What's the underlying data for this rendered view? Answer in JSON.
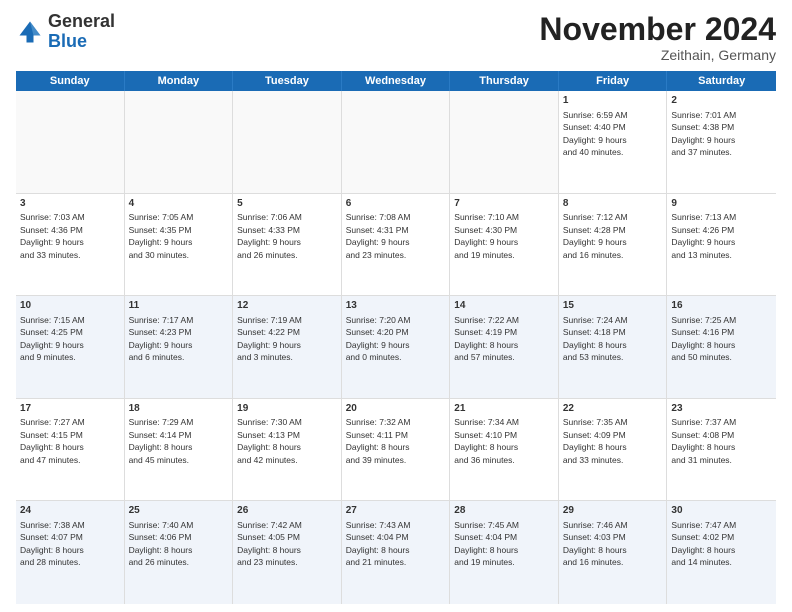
{
  "header": {
    "logo_general": "General",
    "logo_blue": "Blue",
    "month_title": "November 2024",
    "location": "Zeithain, Germany"
  },
  "calendar": {
    "day_headers": [
      "Sunday",
      "Monday",
      "Tuesday",
      "Wednesday",
      "Thursday",
      "Friday",
      "Saturday"
    ],
    "rows": [
      {
        "alt": false,
        "cells": [
          {
            "day": "",
            "info": "",
            "empty": true
          },
          {
            "day": "",
            "info": "",
            "empty": true
          },
          {
            "day": "",
            "info": "",
            "empty": true
          },
          {
            "day": "",
            "info": "",
            "empty": true
          },
          {
            "day": "",
            "info": "",
            "empty": true
          },
          {
            "day": "1",
            "info": "Sunrise: 6:59 AM\nSunset: 4:40 PM\nDaylight: 9 hours\nand 40 minutes.",
            "empty": false
          },
          {
            "day": "2",
            "info": "Sunrise: 7:01 AM\nSunset: 4:38 PM\nDaylight: 9 hours\nand 37 minutes.",
            "empty": false
          }
        ]
      },
      {
        "alt": false,
        "cells": [
          {
            "day": "3",
            "info": "Sunrise: 7:03 AM\nSunset: 4:36 PM\nDaylight: 9 hours\nand 33 minutes.",
            "empty": false
          },
          {
            "day": "4",
            "info": "Sunrise: 7:05 AM\nSunset: 4:35 PM\nDaylight: 9 hours\nand 30 minutes.",
            "empty": false
          },
          {
            "day": "5",
            "info": "Sunrise: 7:06 AM\nSunset: 4:33 PM\nDaylight: 9 hours\nand 26 minutes.",
            "empty": false
          },
          {
            "day": "6",
            "info": "Sunrise: 7:08 AM\nSunset: 4:31 PM\nDaylight: 9 hours\nand 23 minutes.",
            "empty": false
          },
          {
            "day": "7",
            "info": "Sunrise: 7:10 AM\nSunset: 4:30 PM\nDaylight: 9 hours\nand 19 minutes.",
            "empty": false
          },
          {
            "day": "8",
            "info": "Sunrise: 7:12 AM\nSunset: 4:28 PM\nDaylight: 9 hours\nand 16 minutes.",
            "empty": false
          },
          {
            "day": "9",
            "info": "Sunrise: 7:13 AM\nSunset: 4:26 PM\nDaylight: 9 hours\nand 13 minutes.",
            "empty": false
          }
        ]
      },
      {
        "alt": true,
        "cells": [
          {
            "day": "10",
            "info": "Sunrise: 7:15 AM\nSunset: 4:25 PM\nDaylight: 9 hours\nand 9 minutes.",
            "empty": false
          },
          {
            "day": "11",
            "info": "Sunrise: 7:17 AM\nSunset: 4:23 PM\nDaylight: 9 hours\nand 6 minutes.",
            "empty": false
          },
          {
            "day": "12",
            "info": "Sunrise: 7:19 AM\nSunset: 4:22 PM\nDaylight: 9 hours\nand 3 minutes.",
            "empty": false
          },
          {
            "day": "13",
            "info": "Sunrise: 7:20 AM\nSunset: 4:20 PM\nDaylight: 9 hours\nand 0 minutes.",
            "empty": false
          },
          {
            "day": "14",
            "info": "Sunrise: 7:22 AM\nSunset: 4:19 PM\nDaylight: 8 hours\nand 57 minutes.",
            "empty": false
          },
          {
            "day": "15",
            "info": "Sunrise: 7:24 AM\nSunset: 4:18 PM\nDaylight: 8 hours\nand 53 minutes.",
            "empty": false
          },
          {
            "day": "16",
            "info": "Sunrise: 7:25 AM\nSunset: 4:16 PM\nDaylight: 8 hours\nand 50 minutes.",
            "empty": false
          }
        ]
      },
      {
        "alt": false,
        "cells": [
          {
            "day": "17",
            "info": "Sunrise: 7:27 AM\nSunset: 4:15 PM\nDaylight: 8 hours\nand 47 minutes.",
            "empty": false
          },
          {
            "day": "18",
            "info": "Sunrise: 7:29 AM\nSunset: 4:14 PM\nDaylight: 8 hours\nand 45 minutes.",
            "empty": false
          },
          {
            "day": "19",
            "info": "Sunrise: 7:30 AM\nSunset: 4:13 PM\nDaylight: 8 hours\nand 42 minutes.",
            "empty": false
          },
          {
            "day": "20",
            "info": "Sunrise: 7:32 AM\nSunset: 4:11 PM\nDaylight: 8 hours\nand 39 minutes.",
            "empty": false
          },
          {
            "day": "21",
            "info": "Sunrise: 7:34 AM\nSunset: 4:10 PM\nDaylight: 8 hours\nand 36 minutes.",
            "empty": false
          },
          {
            "day": "22",
            "info": "Sunrise: 7:35 AM\nSunset: 4:09 PM\nDaylight: 8 hours\nand 33 minutes.",
            "empty": false
          },
          {
            "day": "23",
            "info": "Sunrise: 7:37 AM\nSunset: 4:08 PM\nDaylight: 8 hours\nand 31 minutes.",
            "empty": false
          }
        ]
      },
      {
        "alt": true,
        "cells": [
          {
            "day": "24",
            "info": "Sunrise: 7:38 AM\nSunset: 4:07 PM\nDaylight: 8 hours\nand 28 minutes.",
            "empty": false
          },
          {
            "day": "25",
            "info": "Sunrise: 7:40 AM\nSunset: 4:06 PM\nDaylight: 8 hours\nand 26 minutes.",
            "empty": false
          },
          {
            "day": "26",
            "info": "Sunrise: 7:42 AM\nSunset: 4:05 PM\nDaylight: 8 hours\nand 23 minutes.",
            "empty": false
          },
          {
            "day": "27",
            "info": "Sunrise: 7:43 AM\nSunset: 4:04 PM\nDaylight: 8 hours\nand 21 minutes.",
            "empty": false
          },
          {
            "day": "28",
            "info": "Sunrise: 7:45 AM\nSunset: 4:04 PM\nDaylight: 8 hours\nand 19 minutes.",
            "empty": false
          },
          {
            "day": "29",
            "info": "Sunrise: 7:46 AM\nSunset: 4:03 PM\nDaylight: 8 hours\nand 16 minutes.",
            "empty": false
          },
          {
            "day": "30",
            "info": "Sunrise: 7:47 AM\nSunset: 4:02 PM\nDaylight: 8 hours\nand 14 minutes.",
            "empty": false
          }
        ]
      }
    ]
  }
}
